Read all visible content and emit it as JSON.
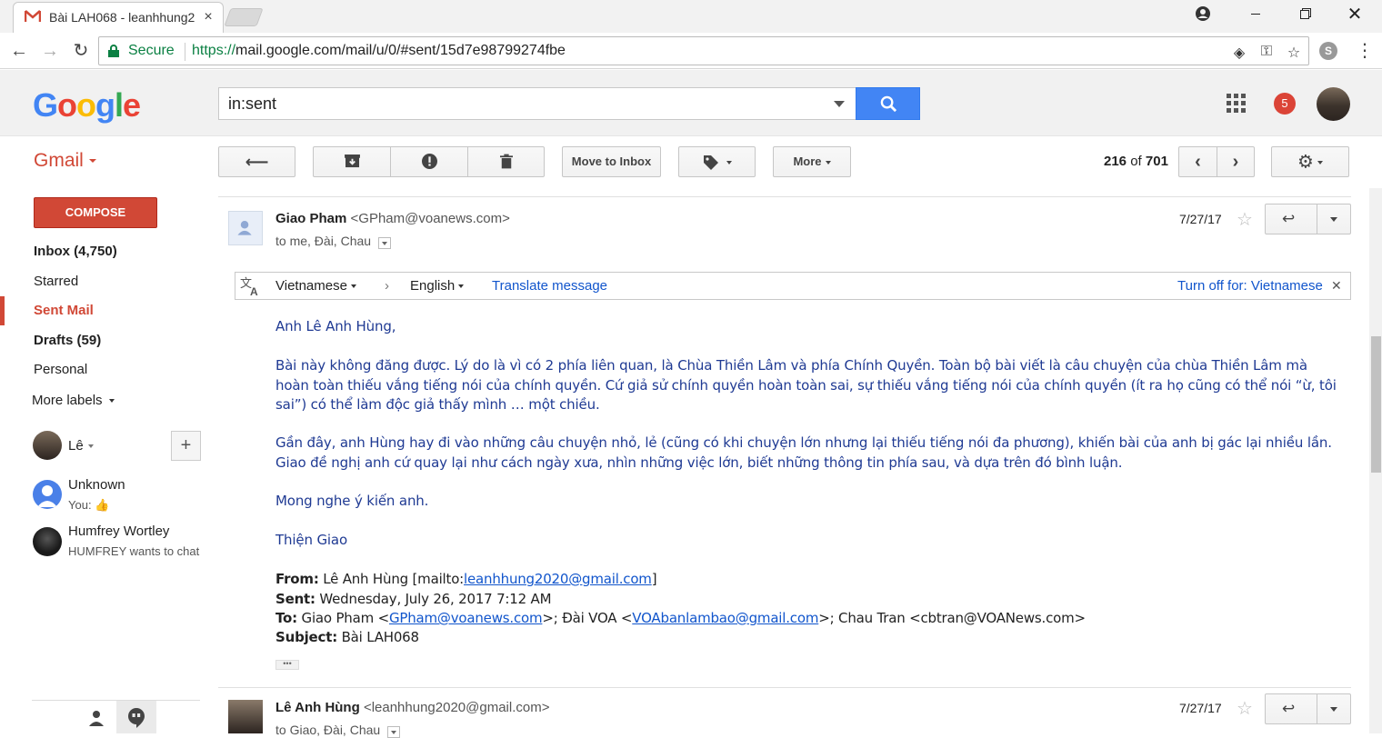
{
  "browser": {
    "tab_title": "Bài LAH068 - leanhhung2",
    "tab_close": "×",
    "secure_label": "Secure",
    "url_proto": "https://",
    "url_rest": "mail.google.com/mail/u/0/#sent/15d7e98799274fbe"
  },
  "header": {
    "logo": "Google",
    "search_query": "in:sent",
    "notification_count": "5",
    "brand_color": "#d14836"
  },
  "toolbar": {
    "gmail_label": "Gmail",
    "move_to_inbox": "Move to Inbox",
    "more": "More",
    "pager_range": "216",
    "pager_of": "of",
    "pager_total": "701"
  },
  "sidebar": {
    "compose": "COMPOSE",
    "items": [
      {
        "label": "Inbox (4,750)"
      },
      {
        "label": "Starred"
      },
      {
        "label": "Sent Mail"
      },
      {
        "label": "Drafts (59)"
      },
      {
        "label": "Personal"
      },
      {
        "label": "More labels"
      }
    ],
    "chat_self": "Lê",
    "chats": [
      {
        "name": "Unknown",
        "sub": "You: 👍"
      },
      {
        "name": "Humfrey Wortley",
        "sub": "HUMFREY wants to chat"
      }
    ]
  },
  "message1": {
    "sender_name": "Giao Pham",
    "sender_email": "<GPham@voanews.com>",
    "recipients": "to me, Đài, Chau",
    "date": "7/27/17"
  },
  "translate": {
    "from_lang": "Vietnamese",
    "to_lang": "English",
    "action": "Translate message",
    "turn_off": "Turn off for: Vietnamese"
  },
  "body": {
    "greeting": "Anh Lê Anh Hùng,",
    "p1": "Bài này không đăng được. Lý do là vì có 2 phía liên quan, là Chùa Thiền Lâm và phía Chính Quyền. Toàn bộ bài viết là câu chuyện của chùa Thiền Lâm mà hoàn toàn thiếu vắng tiếng nói của chính quyền. Cứ giả sử chính quyền hoàn toàn sai, sự thiếu vắng tiếng nói của chính quyền (ít ra họ cũng có thể nói “ừ, tôi sai”) có thể làm độc giả thấy mình … một chiều.",
    "p2": "Gần đây, anh Hùng hay đi vào những câu chuyện nhỏ, lẻ (cũng có khi chuyện lớn nhưng lại thiếu tiếng nói đa phương), khiến bài của anh bị gác lại nhiều lần. Giao đề nghị anh cứ quay lại như cách ngày xưa, nhìn những việc lớn, biết những thông tin phía sau, và dựa trên đó bình luận.",
    "p3": "Mong nghe ý kiến anh.",
    "signature": "Thiện Giao"
  },
  "quoted": {
    "from_label": "From:",
    "from_text": "Lê Anh Hùng [mailto:",
    "from_link": "leanhhung2020@gmail.com",
    "from_end": "]",
    "sent_label": "Sent:",
    "sent_text": "Wednesday, July 26, 2017 7:12 AM",
    "to_label": "To:",
    "to_text1": "Giao Pham <",
    "to_link1": "GPham@voanews.com",
    "to_text2": ">; Đài VOA <",
    "to_link2": "VOAbanlambao@gmail.com",
    "to_text3": ">; Chau Tran <cbtran@VOANews.com>",
    "subject_label": "Subject:",
    "subject_text": "Bài LAH068"
  },
  "message2": {
    "sender_name": "Lê Anh Hùng",
    "sender_email": "<leanhhung2020@gmail.com>",
    "recipients": "to Giao, Đài, Chau",
    "date": "7/27/17"
  }
}
